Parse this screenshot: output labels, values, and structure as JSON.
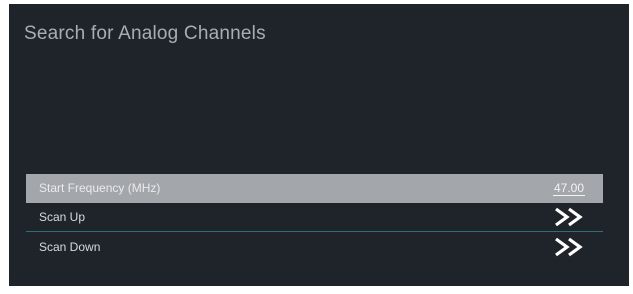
{
  "page": {
    "title": "Search for Analog Channels"
  },
  "menu": {
    "items": [
      {
        "label": "Start Frequency (MHz)",
        "value": "47.00",
        "selected": true
      },
      {
        "label": "Scan Up",
        "icon": "double-chevron-right-icon"
      },
      {
        "label": "Scan Down",
        "icon": "double-chevron-right-icon"
      }
    ]
  },
  "colors": {
    "background": "#1f242b",
    "selected_row": "#a3a6aa",
    "divider": "#2f6e73",
    "text": "#d7dadd"
  }
}
